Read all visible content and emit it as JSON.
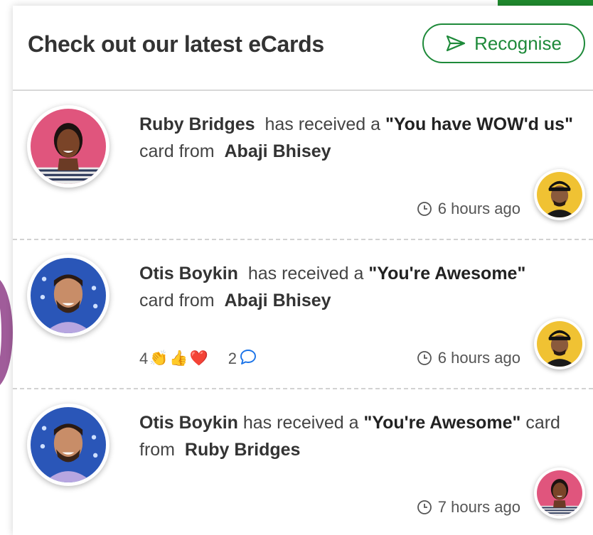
{
  "header": {
    "title": "Check out our latest eCards",
    "recognise_label": "Recognise"
  },
  "feed": [
    {
      "recipient": "Ruby Bridges",
      "text_before": "has received a",
      "card_name": "\"You have WOW'd us\"",
      "text_after": "card from",
      "sender": "Abaji Bhisey",
      "time": "6 hours ago"
    },
    {
      "recipient": "Otis Boykin",
      "text_before": "has received a",
      "card_name": "\"You're Awesome\"",
      "text_after": "card from",
      "sender": "Abaji Bhisey",
      "time": "6 hours ago",
      "reaction_count": "4",
      "reaction_emojis": [
        "👏",
        "👍",
        "❤️"
      ],
      "comment_count": "2"
    },
    {
      "recipient": "Otis Boykin",
      "text_before": "has received a",
      "card_name": "\"You're Awesome\"",
      "text_after": "card",
      "text_after_2": "from",
      "sender": "Ruby Bridges",
      "time": "7 hours ago"
    }
  ],
  "colors": {
    "accent_green": "#1e8a3a",
    "comment_blue": "#1a73e8"
  },
  "icons": {
    "send": "paper-plane-icon",
    "clock": "clock-icon",
    "comment": "speech-bubble-icon"
  }
}
